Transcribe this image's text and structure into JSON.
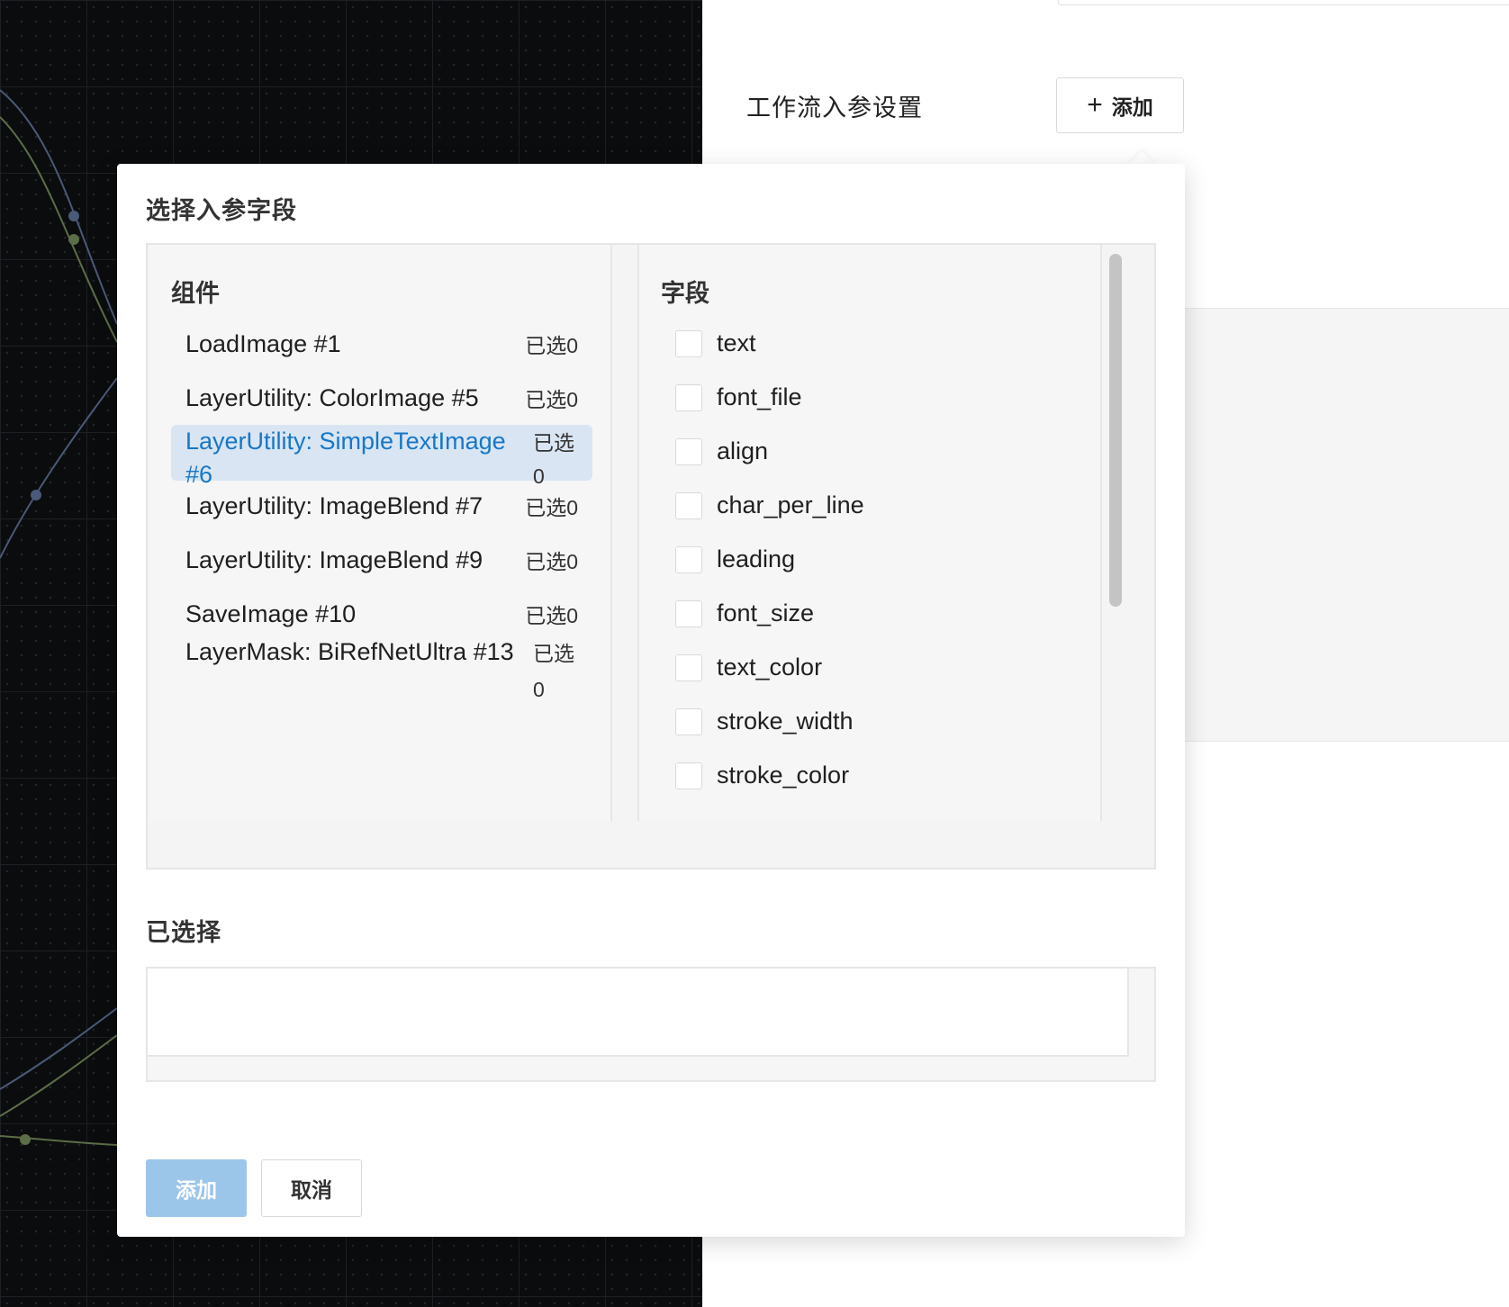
{
  "settings": {
    "label": "工作流入参设置",
    "add_button": {
      "icon": "plus-icon",
      "label": "添加"
    }
  },
  "popover": {
    "title": "选择入参字段",
    "components": {
      "header": "组件",
      "items": [
        {
          "name": "LoadImage #1",
          "count": "已选0"
        },
        {
          "name": "LayerUtility: ColorImage #5",
          "count": "已选0"
        },
        {
          "name": "LayerUtility: SimpleTextImage #6",
          "count": "已选0",
          "selected": true
        },
        {
          "name": "LayerUtility: ImageBlend #7",
          "count": "已选0"
        },
        {
          "name": "LayerUtility: ImageBlend #9",
          "count": "已选0"
        },
        {
          "name": "SaveImage #10",
          "count": "已选0"
        },
        {
          "name": "LayerMask: BiRefNetUltra #13",
          "count": "已选0"
        }
      ]
    },
    "fields": {
      "header": "字段",
      "items": [
        {
          "label": "text",
          "checked": false
        },
        {
          "label": "font_file",
          "checked": false
        },
        {
          "label": "align",
          "checked": false
        },
        {
          "label": "char_per_line",
          "checked": false
        },
        {
          "label": "leading",
          "checked": false
        },
        {
          "label": "font_size",
          "checked": false
        },
        {
          "label": "text_color",
          "checked": false
        },
        {
          "label": "stroke_width",
          "checked": false
        },
        {
          "label": "stroke_color",
          "checked": false
        }
      ]
    },
    "selected_section": {
      "label": "已选择"
    },
    "actions": {
      "confirm": "添加",
      "cancel": "取消"
    }
  },
  "colors": {
    "primary_disabled": "#9cc5ea",
    "link_selected": "#1677c8",
    "row_selected_bg": "#d9e5f2",
    "canvas_bg": "#0b0c0e"
  }
}
